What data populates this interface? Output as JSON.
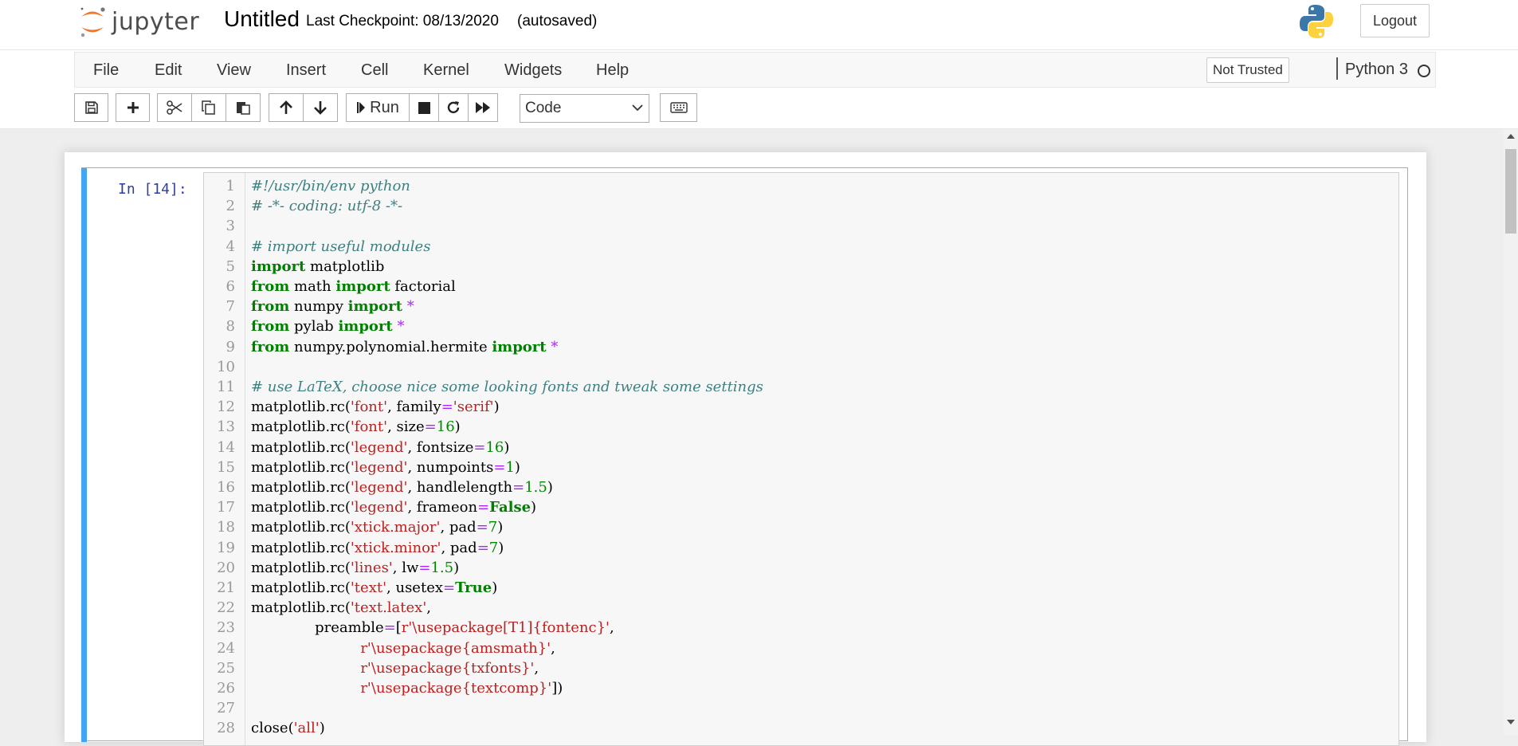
{
  "header": {
    "logo_text": "jupyter",
    "notebook_name": "Untitled",
    "checkpoint": "Last Checkpoint: 08/13/2020",
    "autosave": "(autosaved)",
    "logout_label": "Logout"
  },
  "menubar": {
    "items": [
      "File",
      "Edit",
      "View",
      "Insert",
      "Cell",
      "Kernel",
      "Widgets",
      "Help"
    ],
    "trust_status": "Not Trusted",
    "kernel_name": "Python 3"
  },
  "toolbar": {
    "run_label": "Run",
    "cell_type": "Code",
    "icons": [
      "save-icon",
      "plus-icon",
      "cut-icon",
      "copy-icon",
      "paste-icon",
      "arrow-up-icon",
      "arrow-down-icon",
      "step-forward-icon",
      "stop-icon",
      "restart-icon",
      "fast-forward-icon",
      "keyboard-icon"
    ]
  },
  "cell": {
    "prompt": "In  [14]:",
    "line_numbers": [
      "1",
      "2",
      "3",
      "4",
      "5",
      "6",
      "7",
      "8",
      "9",
      "10",
      "11",
      "12",
      "13",
      "14",
      "15",
      "16",
      "17",
      "18",
      "19",
      "20",
      "21",
      "22",
      "23",
      "24",
      "25",
      "26",
      "27",
      "28"
    ],
    "lines": [
      "#!/usr/bin/env python",
      "# -*- coding: utf-8 -*-",
      "",
      "# import useful modules",
      "import matplotlib",
      "from math import factorial",
      "from numpy import *",
      "from pylab import *",
      "from numpy.polynomial.hermite import *",
      "",
      "# use LaTeX, choose nice some looking fonts and tweak some settings",
      "matplotlib.rc('font', family='serif')",
      "matplotlib.rc('font', size=16)",
      "matplotlib.rc('legend', fontsize=16)",
      "matplotlib.rc('legend', numpoints=1)",
      "matplotlib.rc('legend', handlelength=1.5)",
      "matplotlib.rc('legend', frameon=False)",
      "matplotlib.rc('xtick.major', pad=7)",
      "matplotlib.rc('xtick.minor', pad=7)",
      "matplotlib.rc('lines', lw=1.5)",
      "matplotlib.rc('text', usetex=True)",
      "matplotlib.rc('text.latex',",
      "              preamble=[r'\\usepackage[T1]{fontenc}',",
      "                        r'\\usepackage{amsmath}',",
      "                        r'\\usepackage{txfonts}',",
      "                        r'\\usepackage{textcomp}'])",
      "",
      "close('all')"
    ]
  },
  "colors": {
    "cell_selected_bar": "#42a5f5",
    "prompt_in": "#303f9f",
    "comment": "#408080",
    "keyword": "#008000",
    "string": "#ba2121",
    "number": "#008800",
    "operator": "#aa22ff"
  }
}
